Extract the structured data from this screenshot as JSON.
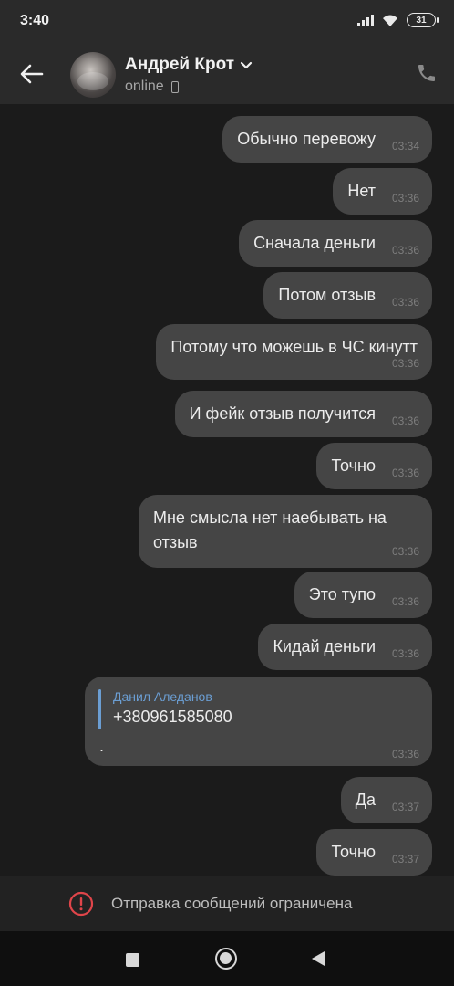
{
  "status_bar": {
    "time": "3:40",
    "battery": "31"
  },
  "header": {
    "contact_name": "Андрей Крот",
    "status": "online"
  },
  "icons": {
    "back": "arrow-left-icon",
    "chevron": "chevron-down-icon",
    "device": "mobile-icon",
    "call": "phone-icon",
    "warning": "exclamation-circle-icon"
  },
  "messages": [
    {
      "text": "Обычно перевожу",
      "time": "03:34"
    },
    {
      "text": "Нет",
      "time": "03:36"
    },
    {
      "text": "Сначала деньги",
      "time": "03:36"
    },
    {
      "text": "Потом отзыв",
      "time": "03:36"
    },
    {
      "text": "Потому что можешь в ЧС кинутт",
      "time": "03:36"
    },
    {
      "text": "И фейк отзыв получится",
      "time": "03:36"
    },
    {
      "text": "Точно",
      "time": "03:36"
    },
    {
      "text": "Мне смысла нет наебывать на отзыв",
      "time": "03:36"
    },
    {
      "text": "Это тупо",
      "time": "03:36"
    },
    {
      "text": "Кидай деньги",
      "time": "03:36"
    },
    {
      "text": "Да",
      "time": "03:37"
    },
    {
      "text": "Точно",
      "time": "03:37"
    }
  ],
  "contact_message": {
    "author": "Данил Аледанов",
    "phone": "+380961585080",
    "text": ".",
    "time": "03:36"
  },
  "footer": {
    "restricted_text": "Отправка сообщений ограничена"
  },
  "colors": {
    "bubble": "#454545",
    "background": "#1b1b1b",
    "accent": "#6b9ed3",
    "warning": "#e0454a"
  }
}
